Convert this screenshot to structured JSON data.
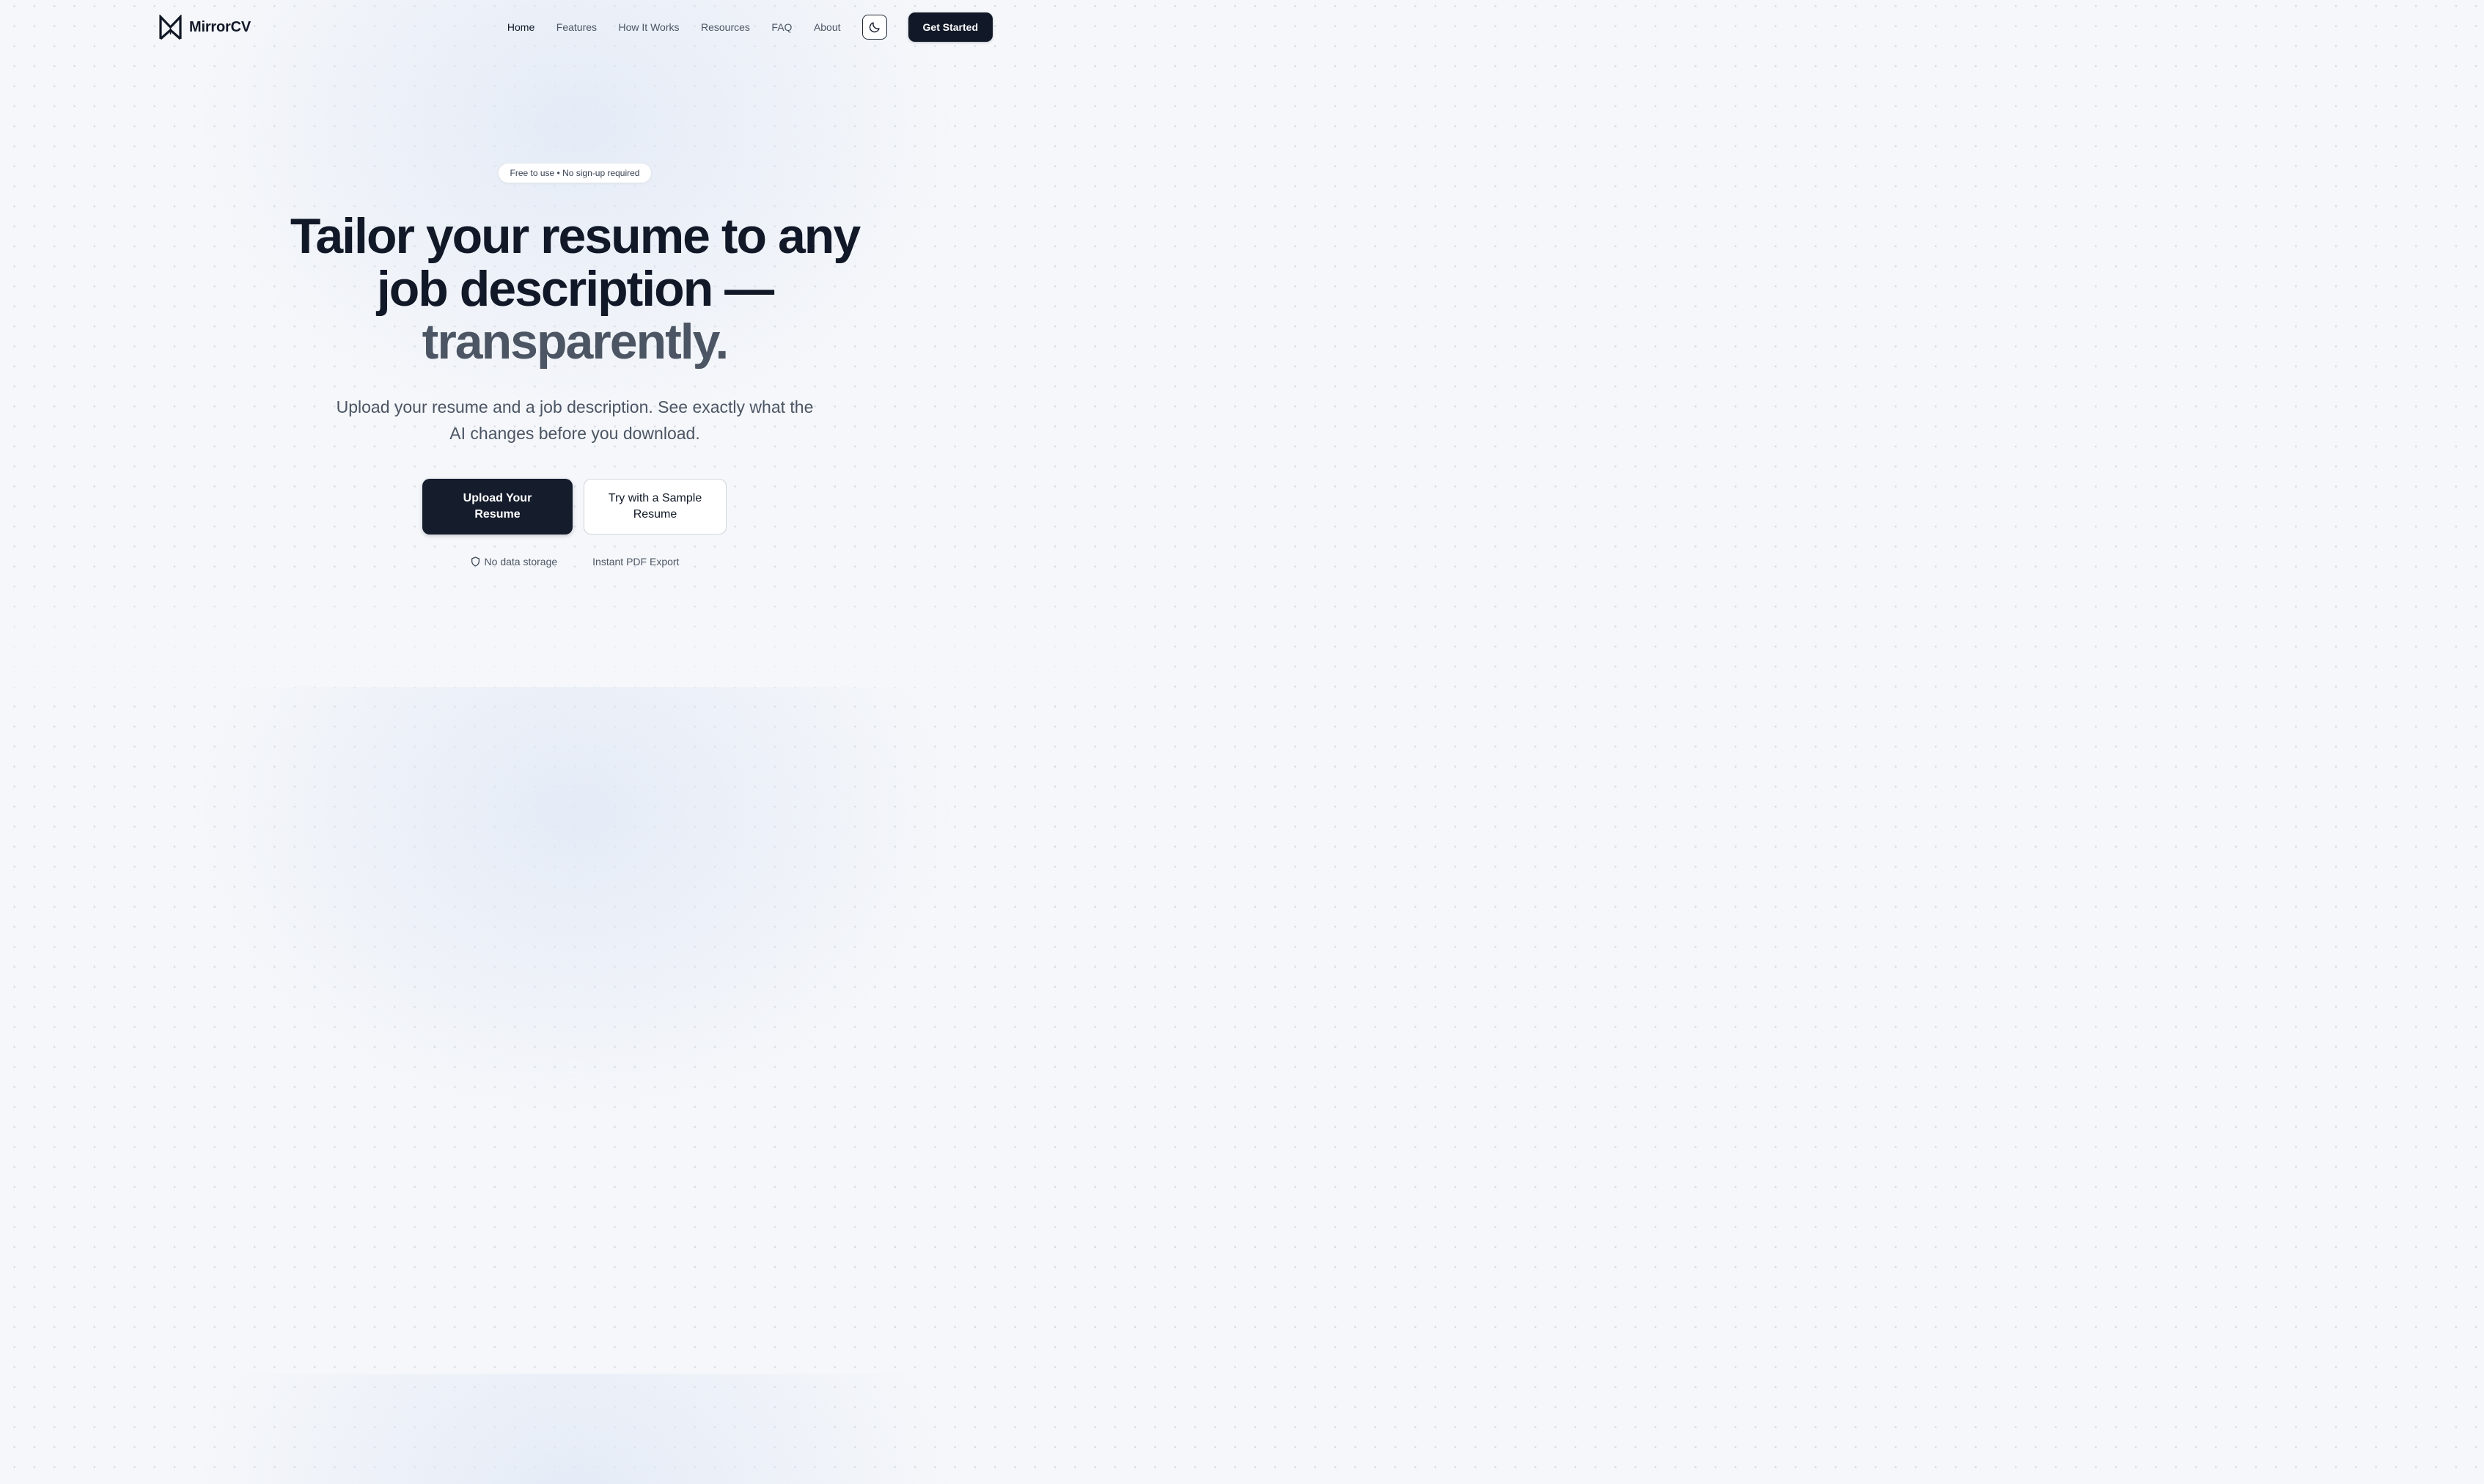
{
  "brand": {
    "name": "MirrorCV",
    "logo_icon": "mirror-m-logo-icon"
  },
  "nav": {
    "links": [
      "Home",
      "Features",
      "How It Works",
      "Resources",
      "FAQ",
      "About"
    ],
    "active": "Home",
    "theme_toggle_icon": "moon-icon",
    "cta_label": "Get Started"
  },
  "hero": {
    "badge": "Free to use • No sign-up required",
    "headline_line1": "Tailor your resume to any",
    "headline_line2": "job description —",
    "headline_accent": "transparently.",
    "subheadline": "Upload your resume and a job description. See exactly what the AI changes before you download.",
    "primary_button": "Upload Your Resume",
    "secondary_button": "Try with a Sample Resume"
  },
  "features": [
    {
      "icon": "shield-icon",
      "label": "No data storage"
    },
    {
      "icon": "",
      "label": "Instant PDF Export"
    }
  ],
  "colors": {
    "primary": "#111827",
    "muted_text": "#4b5563",
    "background": "#f5f7fa"
  }
}
